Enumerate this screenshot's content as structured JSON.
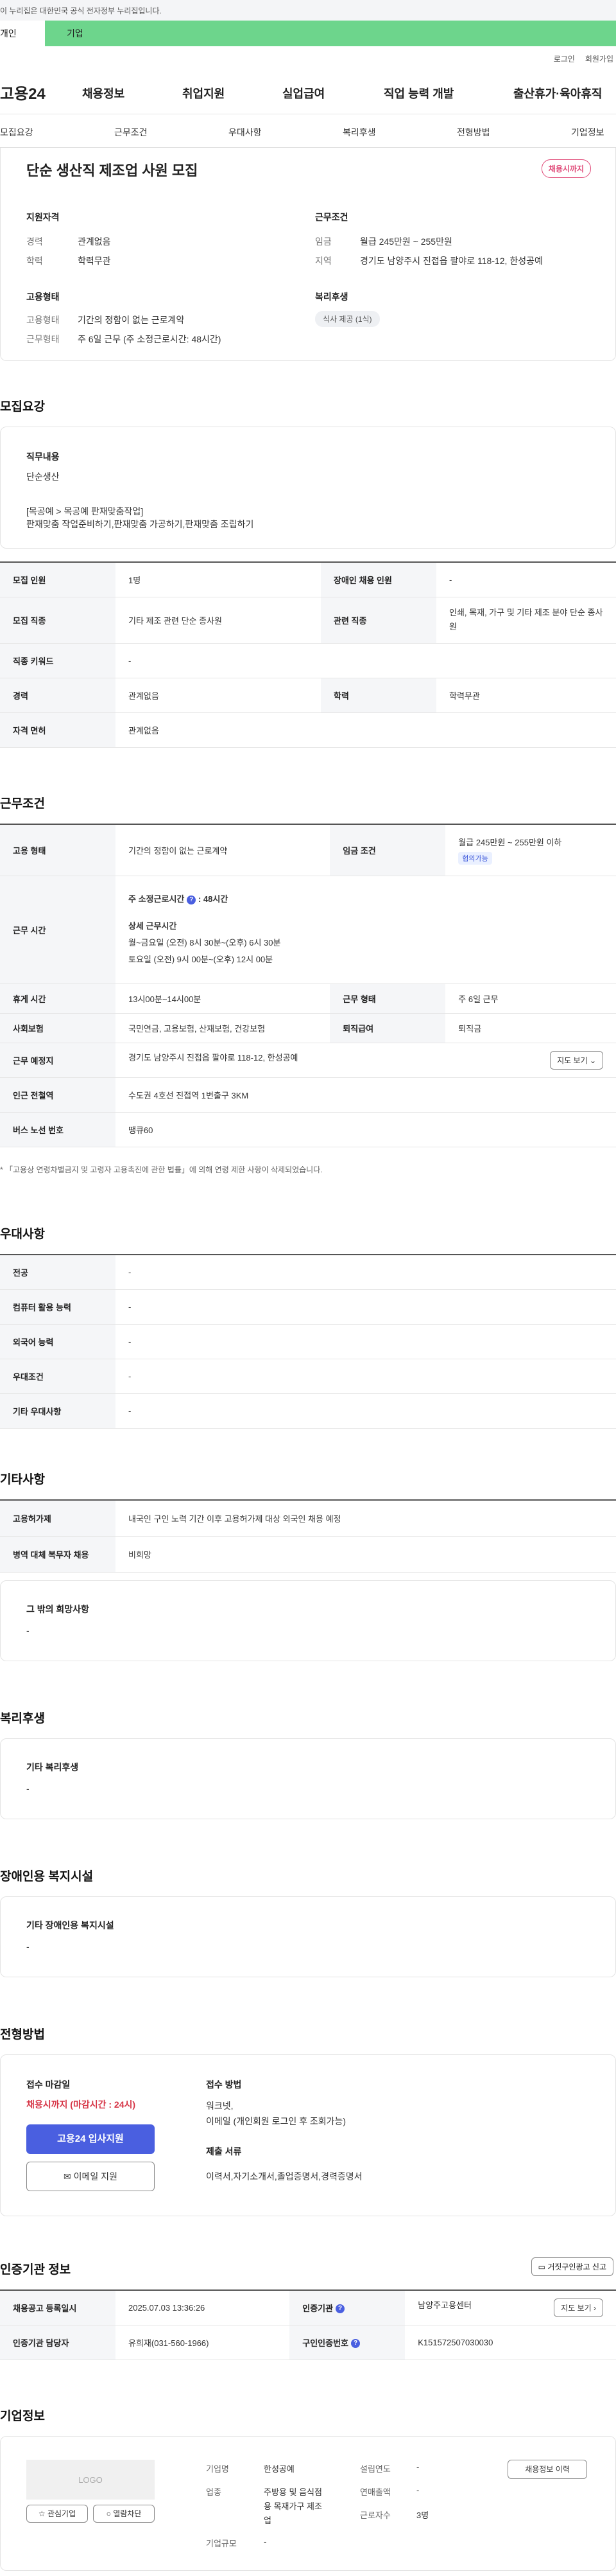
{
  "gov_banner": "이 누리집은 대한민국 공식 전자정부 누리집입니다.",
  "tabs": {
    "individual": "개인",
    "business": "기업"
  },
  "util": {
    "login": "로그인",
    "join": "회원가입"
  },
  "gnb": {
    "logo": "고용24",
    "items": [
      "채용정보",
      "취업지원",
      "실업급여",
      "직업 능력 개발",
      "출산휴가·육아휴직"
    ]
  },
  "anchor": [
    "모집요강",
    "근무조건",
    "우대사항",
    "복리후생",
    "전형방법",
    "기업정보"
  ],
  "summary": {
    "title": "단순 생산직 제조업 사원 모집",
    "badge": "채용시까지",
    "qual": {
      "heading": "지원자격",
      "career_k": "경력",
      "career_v": "관계없음",
      "edu_k": "학력",
      "edu_v": "학력무관"
    },
    "cond": {
      "heading": "근무조건",
      "wage_k": "임금",
      "wage_v": "월급 245만원 ~ 255만원",
      "region_k": "지역",
      "region_v": "경기도 남양주시 진접읍 팔야로 118-12, 한성공예"
    },
    "emp": {
      "heading": "고용형태",
      "type_k": "고용형태",
      "type_v": "기간의 정함이 없는 근로계약",
      "work_k": "근무형태",
      "work_v": "주 6일 근무 (주 소정근로시간: 48시간)"
    },
    "welfare": {
      "heading": "복리후생",
      "chip": "식사 제공 (1식)"
    }
  },
  "recruit": {
    "heading": "모집요강",
    "duty_title": "직무내용",
    "duty_body": "단순생산",
    "duty_detail1": "[목공예 > 목공예 판재맞춤작업]",
    "duty_detail2": "판재맞춤 작업준비하기,판재맞춤 가공하기,판재맞춤 조립하기",
    "rows": [
      [
        "모집 인원",
        "1명",
        "장애인 채용 인원",
        "-"
      ],
      [
        "모집 직종",
        "기타 제조 관련 단순 종사원",
        "관련 직종",
        "인쇄, 목재, 가구 및 기타 제조 분야 단순 종사원"
      ],
      [
        "직종 키워드",
        "-",
        "",
        ""
      ],
      [
        "경력",
        "관계없음",
        "학력",
        "학력무관"
      ],
      [
        "자격 면허",
        "관계없음",
        "",
        ""
      ]
    ]
  },
  "work": {
    "heading": "근무조건",
    "type_k": "고용 형태",
    "type_v": "기간의 정함이 없는 근로계약",
    "wage_k": "임금 조건",
    "wage_v": "월급 245만원 ~ 255만원 이하",
    "wage_chip": "협의가능",
    "hours_k": "근무 시간",
    "hours_title": "주 소정근로시간",
    "hours_value": ": 48시간",
    "detail_title": "상세 근무시간",
    "detail1": "월~금요일 (오전) 8시 30분~(오후) 6시 30분",
    "detail2": "토요일 (오전) 9시 00분~(오후) 12시 00분",
    "break_k": "휴게 시간",
    "break_v": "13시00분~14시00분",
    "form_k": "근무 형태",
    "form_v": "주 6일 근무",
    "ins_k": "사회보험",
    "ins_v": "국민연금, 고용보험, 산재보험, 건강보험",
    "sev_k": "퇴직급여",
    "sev_v": "퇴직금",
    "place_k": "근무 예정지",
    "place_v": "경기도 남양주시 진접읍 팔야로 118-12, 한성공예",
    "map_btn": "지도 보기",
    "sub_k": "인근 전철역",
    "sub_v": "수도권 4호선 진접역 1번출구 3KM",
    "bus_k": "버스 노선 번호",
    "bus_v": "땡큐60",
    "note": "* 「고용상 연령차별금지 및 고령자 고용촉진에 관한 법률」에 의해 연령 제한 사항이 삭제되었습니다."
  },
  "pref": {
    "heading": "우대사항",
    "rows": [
      [
        "전공",
        "-"
      ],
      [
        "컴퓨터 활용 능력",
        "-"
      ],
      [
        "외국어 능력",
        "-"
      ],
      [
        "우대조건",
        "-"
      ],
      [
        "기타 우대사항",
        "-"
      ]
    ]
  },
  "etc": {
    "heading": "기타사항",
    "rows": [
      [
        "고용허가제",
        "내국인 구인 노력 기간 이후 고용허가제 대상 외국인 채용 예정"
      ],
      [
        "병역 대체 복무자 채용",
        "비희망"
      ]
    ],
    "other_title": "그 밖의 희망사항",
    "other_body": "-"
  },
  "welfare": {
    "heading": "복리후생",
    "title": "기타 복리후생",
    "body": "-"
  },
  "disability": {
    "heading": "장애인용 복지시설",
    "title": "기타 장애인용 복지시설",
    "body": "-"
  },
  "process": {
    "heading": "전형방법",
    "deadline_k": "접수 마감일",
    "deadline_v": "채용시까지 (마감시간 : 24시)",
    "apply_btn": "고용24 입사지원",
    "email_btn": "이메일 지원",
    "method_k": "접수 방법",
    "method_v1": "워크넷,",
    "method_v2": "이메일 (개인회원 로그인 후 조회가능)",
    "docs_k": "제출 서류",
    "docs_v": "이력서,자기소개서,졸업증명서,경력증명서"
  },
  "agency": {
    "heading": "인증기관 정보",
    "report_btn": "거짓구인광고 신고",
    "date_k": "채용공고 등록일시",
    "date_v": "2025.07.03 13:36:26",
    "org_k": "인증기관",
    "org_v": "남양주고용센터",
    "map_btn": "지도 보기",
    "mgr_k": "인증기관 담당자",
    "mgr_v": "유희재(031-560-1966)",
    "no_k": "구인인증번호",
    "no_v": "K151572507030030"
  },
  "company": {
    "heading": "기업정보",
    "logo": "LOGO",
    "fav_btn": "관심기업",
    "follow_btn": "열람차단",
    "info_btn": "채용정보 이력",
    "name_k": "기업명",
    "name_v": "한성공예",
    "year_k": "설립연도",
    "year_v": "-",
    "ind_k": "업종",
    "ind_v1": "주방용 및 음식점",
    "ind_v2": "용 목재가구 제조",
    "ind_v3": "업",
    "sales_k": "연매출액",
    "sales_v": "-",
    "emp_k": "근로자수",
    "emp_v": "3명",
    "scale_k": "기업규모",
    "scale_v": "-"
  },
  "colors": {
    "accent": "#4a5fe0",
    "badge": "#e04b79",
    "business_tab": "#6dd58c",
    "deadline": "#d63344"
  }
}
